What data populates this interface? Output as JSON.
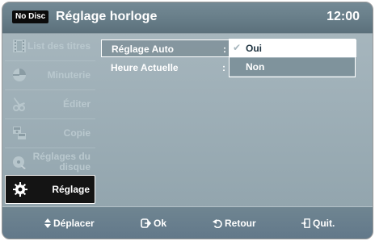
{
  "header": {
    "badge": "No Disc",
    "title": "Réglage horloge",
    "time": "12:00"
  },
  "sidebar": {
    "items": [
      {
        "label": "List des titres",
        "icon": "film-icon",
        "active": false
      },
      {
        "label": "Minuterie",
        "icon": "timer-icon",
        "active": false
      },
      {
        "label": "Éditer",
        "icon": "scissors-icon",
        "active": false
      },
      {
        "label": "Copie",
        "icon": "copy-icon",
        "active": false
      },
      {
        "label": "Réglages du disque",
        "icon": "disc-icon",
        "active": false
      },
      {
        "label": "Réglage",
        "icon": "gear-icon",
        "active": true
      }
    ]
  },
  "settings": {
    "rows": [
      {
        "label": "Réglage Auto",
        "separator": ":"
      },
      {
        "label": "Heure Actuelle",
        "separator": ":"
      }
    ],
    "dropdown": {
      "options": [
        "Oui",
        "Non"
      ],
      "selected": "Oui",
      "check": "✔"
    }
  },
  "footer": {
    "move": "Déplacer",
    "ok": "Ok",
    "back": "Retour",
    "quit": "Quit."
  },
  "colors": {
    "panel": "#9fb0b8",
    "header": "#677d88",
    "active_bg": "#141414",
    "dropdown_selected_text": "#1e3340"
  }
}
